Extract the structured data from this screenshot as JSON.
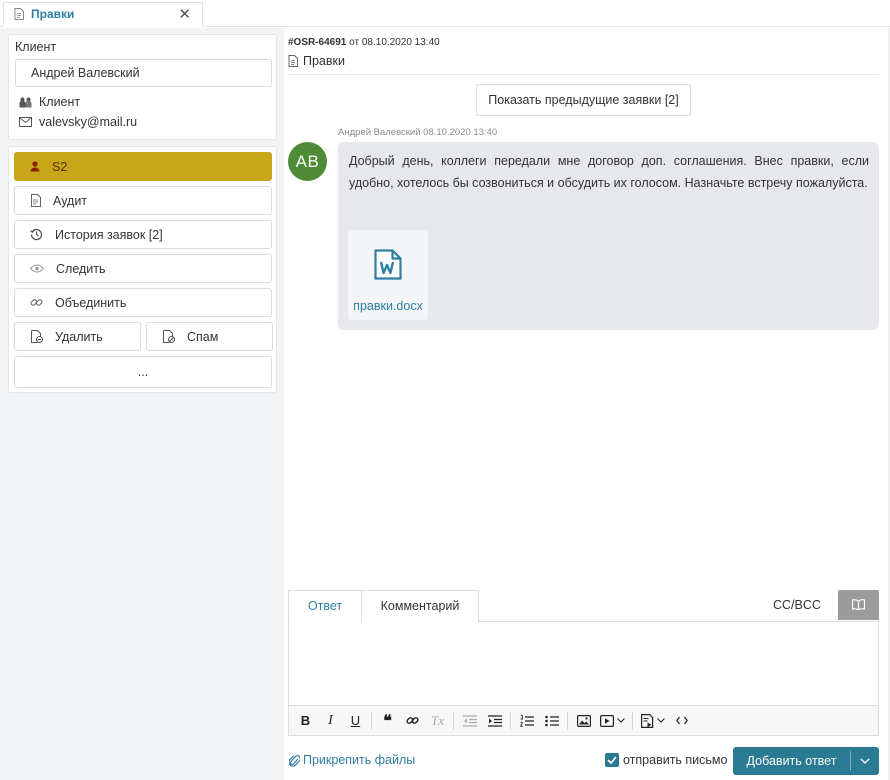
{
  "tab": {
    "title": "Правки",
    "close": "✕"
  },
  "client": {
    "label": "Клиент",
    "name": "Андрей Валевский",
    "role": "Клиент",
    "email": "valevsky@mail.ru"
  },
  "actions": {
    "assignee": "S2",
    "audit": "Аудит",
    "history": "История заявок [2]",
    "follow": "Следить",
    "merge": "Объединить",
    "delete": "Удалить",
    "spam": "Спам",
    "more": "..."
  },
  "ticket": {
    "id": "#OSR-64691",
    "from_word": " от ",
    "datetime": "08.10.2020 13:40",
    "subject": "Правки"
  },
  "prev_button": "Показать предыдущие заявки [2]",
  "message": {
    "meta": "Андрей Валевский 08.10.2020 13:40",
    "avatar_initials": "AB",
    "text": "Добрый день, коллеги передали мне договор доп. соглашения. Внес правки, если удобно, хотелось бы созвониться и обсудить их голосом. Назначьте встречу пожалуйста.",
    "attachment": "правки.docx"
  },
  "reply": {
    "tab_answer": "Ответ",
    "tab_comment": "Комментарий",
    "ccbcc": "CC/BCC",
    "toolbar": {
      "bold": "B",
      "italic": "I",
      "underline": "U",
      "quote": "❝",
      "clear_format": "Tx"
    },
    "attach_files": "Прикрепить файлы",
    "send_email": "отправить письмо",
    "submit": "Добавить ответ"
  },
  "colors": {
    "accent": "#2b7a93",
    "link": "#2f7ea3",
    "assignee_bg": "#c9a51a",
    "avatar_bg": "#4f8a37",
    "bubble_bg": "#e6e8ec"
  }
}
